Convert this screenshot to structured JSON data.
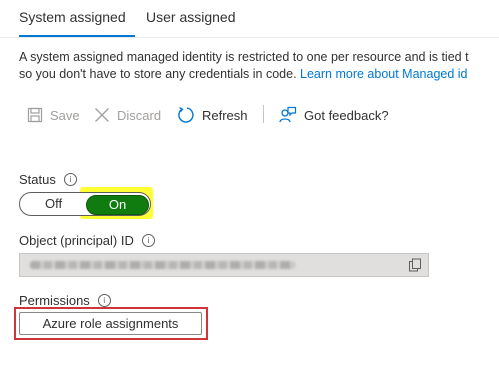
{
  "tabs": [
    {
      "label": "System assigned",
      "active": true
    },
    {
      "label": "User assigned",
      "active": false
    }
  ],
  "description": {
    "line1": "A system assigned managed identity is restricted to one per resource and is tied t",
    "line2_text": "so you don't have to store any credentials in code. ",
    "line2_link": "Learn more about Managed id"
  },
  "toolbar": {
    "save_label": "Save",
    "discard_label": "Discard",
    "refresh_label": "Refresh",
    "feedback_label": "Got feedback?"
  },
  "status": {
    "label": "Status",
    "off_label": "Off",
    "on_label": "On",
    "value": "On"
  },
  "object_id": {
    "label": "Object (principal) ID"
  },
  "permissions": {
    "label": "Permissions",
    "button_label": "Azure role assignments"
  },
  "colors": {
    "accent": "#0078d4",
    "toggle_on": "#107c10",
    "highlight": "#ffff33",
    "callout_border": "#d13438"
  },
  "icons": {
    "info": "info-icon",
    "save": "save-icon",
    "discard": "discard-x-icon",
    "refresh": "refresh-icon",
    "feedback": "feedback-person-icon",
    "copy": "copy-icon"
  }
}
